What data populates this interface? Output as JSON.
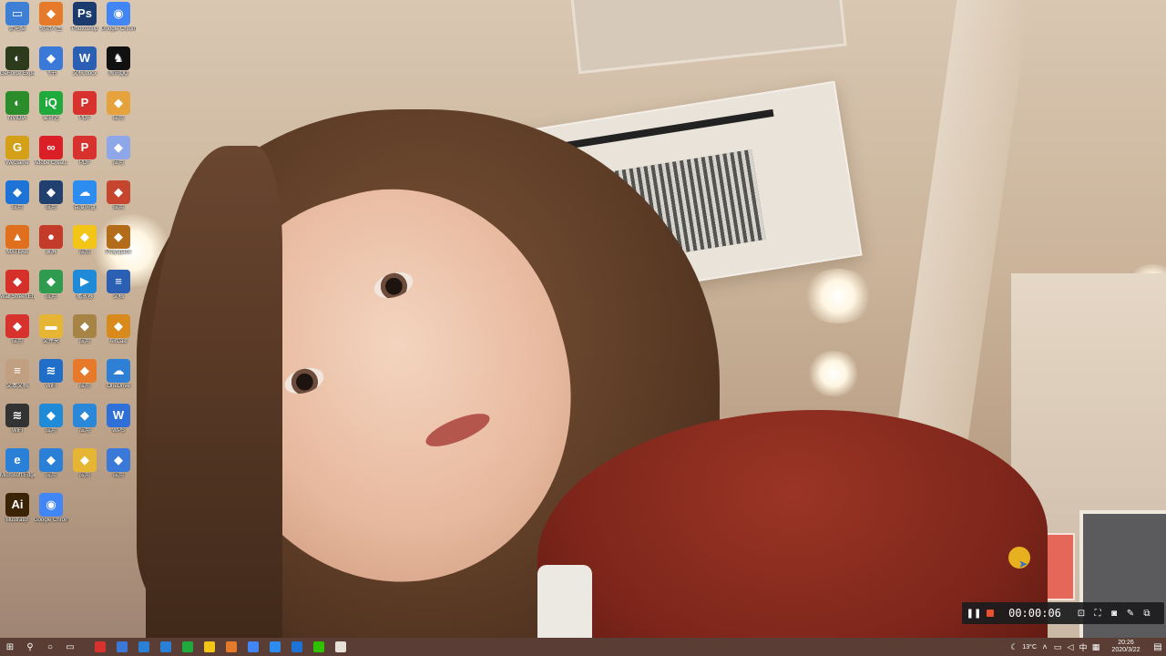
{
  "desktop": {
    "icons": [
      {
        "label": "此电脑",
        "icon": "computer-icon",
        "color": "#3d7fd4"
      },
      {
        "label": "驱动人生",
        "icon": "app-icon",
        "color": "#e57a2a"
      },
      {
        "label": "Photoshop",
        "icon": "photoshop-icon",
        "color": "#1b3b6f"
      },
      {
        "label": "Google Chrome",
        "icon": "chrome-icon",
        "color": "#4285f4"
      },
      {
        "label": "GeForce Experience",
        "icon": "nvidia-icon",
        "color": "#2d3b1d"
      },
      {
        "label": "飞书",
        "icon": "app-icon",
        "color": "#3a79d8"
      },
      {
        "label": "文档.docx",
        "icon": "word-doc-icon",
        "color": "#2b5fb4"
      },
      {
        "label": "腾讯QQ",
        "icon": "qq-icon",
        "color": "#111111"
      },
      {
        "label": "NVIDIA",
        "icon": "nvidia-icon",
        "color": "#2a8c2a"
      },
      {
        "label": "爱奇艺",
        "icon": "iqiyi-icon",
        "color": "#1faa3b"
      },
      {
        "label": "PDF",
        "icon": "pdf-icon",
        "color": "#d8322e"
      },
      {
        "label": "应用",
        "icon": "app-icon",
        "color": "#e6a23c"
      },
      {
        "label": "WeGame",
        "icon": "wegame-icon",
        "color": "#d4a017"
      },
      {
        "label": "Adobe Creati...",
        "icon": "adobe-cc-icon",
        "color": "#da1f26"
      },
      {
        "label": "PDF",
        "icon": "pdf-icon",
        "color": "#d8322e"
      },
      {
        "label": "应用",
        "icon": "app-icon",
        "color": "#8ea7e8"
      },
      {
        "label": "应用",
        "icon": "app-icon",
        "color": "#1e73d6"
      },
      {
        "label": "应用",
        "icon": "app-icon",
        "color": "#20406f"
      },
      {
        "label": "百度网盘",
        "icon": "cloud-icon",
        "color": "#2d8cf0"
      },
      {
        "label": "应用",
        "icon": "app-icon",
        "color": "#c6452f"
      },
      {
        "label": "MATLAB",
        "icon": "matlab-icon",
        "color": "#e0701d"
      },
      {
        "label": "录屏",
        "icon": "record-icon",
        "color": "#c43b2a"
      },
      {
        "label": "应用",
        "icon": "app-icon",
        "color": "#f2c517"
      },
      {
        "label": "Polyspace",
        "icon": "app-icon",
        "color": "#b26c1a"
      },
      {
        "label": "Wall Street English",
        "icon": "app-icon",
        "color": "#d6302a"
      },
      {
        "label": "应用",
        "icon": "app-icon",
        "color": "#2e9b4e"
      },
      {
        "label": "播放器",
        "icon": "player-icon",
        "color": "#1f8ad8"
      },
      {
        "label": "文档",
        "icon": "doc-icon",
        "color": "#2b5fb4"
      },
      {
        "label": "应用",
        "icon": "app-icon",
        "color": "#d8322e"
      },
      {
        "label": "文件夹",
        "icon": "folder-icon",
        "color": "#e7b534"
      },
      {
        "label": "应用",
        "icon": "app-icon",
        "color": "#a68446"
      },
      {
        "label": "AirCalc",
        "icon": "app-icon",
        "color": "#d88a1d"
      },
      {
        "label": "文本文档",
        "icon": "text-file-icon",
        "color": "#c0a080"
      },
      {
        "label": "WiFi",
        "icon": "wifi-icon",
        "color": "#1f6fc9"
      },
      {
        "label": "应用",
        "icon": "app-icon",
        "color": "#e7792a"
      },
      {
        "label": "OneDrive",
        "icon": "cloud-icon",
        "color": "#2e7fd6"
      },
      {
        "label": "WiFi",
        "icon": "wifi-icon",
        "color": "#333333"
      },
      {
        "label": "应用",
        "icon": "app-icon",
        "color": "#1f8ad8"
      },
      {
        "label": "应用",
        "icon": "app-icon",
        "color": "#2b88d8"
      },
      {
        "label": "WPS",
        "icon": "wps-icon",
        "color": "#2e6fd8"
      },
      {
        "label": "Microsoft Edge",
        "icon": "edge-icon",
        "color": "#2a7fd6"
      },
      {
        "label": "应用",
        "icon": "app-icon",
        "color": "#2a7fd6"
      },
      {
        "label": "应用",
        "icon": "app-icon",
        "color": "#e7b534"
      },
      {
        "label": "应用",
        "icon": "app-icon",
        "color": "#3a79d8"
      },
      {
        "label": "Illustrator",
        "icon": "illustrator-icon",
        "color": "#3b2406"
      },
      {
        "label": "Google Chrome",
        "icon": "chrome-icon",
        "color": "#4285f4"
      }
    ]
  },
  "recorder": {
    "timer": "00:00:06",
    "pause_icon": "pause-icon",
    "stop_icon": "stop-icon",
    "tools": [
      "region-icon",
      "fullscreen-icon",
      "camera-icon",
      "pen-icon",
      "minimize-icon"
    ]
  },
  "taskbar": {
    "start_icon": "windows-start-icon",
    "apps": [
      {
        "icon": "app-icon",
        "color": "#d8322e"
      },
      {
        "icon": "app-icon",
        "color": "#3a79d8"
      },
      {
        "icon": "edge-icon",
        "color": "#2a7fd6"
      },
      {
        "icon": "edge-icon",
        "color": "#2a7fd6"
      },
      {
        "icon": "app-icon",
        "color": "#1faa3b"
      },
      {
        "icon": "app-icon",
        "color": "#f2c517"
      },
      {
        "icon": "app-icon",
        "color": "#e57a2a"
      },
      {
        "icon": "chrome-icon",
        "color": "#4285f4"
      },
      {
        "icon": "app-icon",
        "color": "#2d8cf0"
      },
      {
        "icon": "app-icon",
        "color": "#1e73d6"
      },
      {
        "icon": "wechat-icon",
        "color": "#2dc100"
      },
      {
        "icon": "app-icon",
        "color": "#e6e0d8"
      }
    ],
    "tray": {
      "temperature": "13°C",
      "ime": "中",
      "time": "20:26",
      "date": "2020/3/22"
    }
  }
}
